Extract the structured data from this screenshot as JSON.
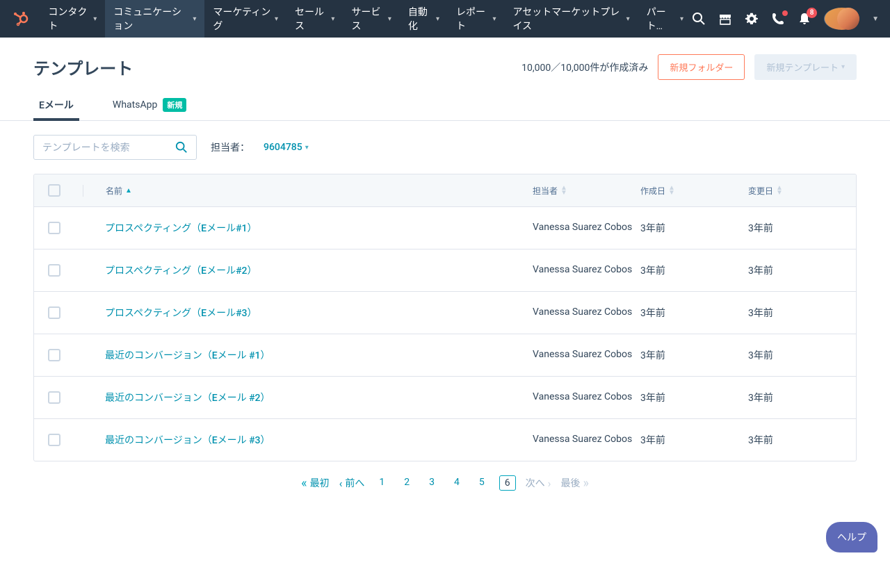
{
  "nav": {
    "items": [
      {
        "label": "コンタクト",
        "active": false
      },
      {
        "label": "コミュニケーション",
        "active": true
      },
      {
        "label": "マーケティング",
        "active": false
      },
      {
        "label": "セールス",
        "active": false
      },
      {
        "label": "サービス",
        "active": false
      },
      {
        "label": "自動化",
        "active": false
      },
      {
        "label": "レポート",
        "active": false
      },
      {
        "label": "アセットマーケットプレイス",
        "active": false
      },
      {
        "label": "パート…",
        "active": false
      }
    ],
    "notification_count": "8"
  },
  "page": {
    "title": "テンプレート",
    "count_text": "10,000／10,000件が作成済み",
    "new_folder_btn": "新規フォルダー",
    "new_template_btn": "新規テンプレート"
  },
  "tabs": {
    "email": "Eメール",
    "whatsapp": "WhatsApp",
    "new_badge": "新規"
  },
  "toolbar": {
    "search_placeholder": "テンプレートを検索",
    "filter_label": "担当者：",
    "filter_value": "9604785"
  },
  "table": {
    "headers": {
      "name": "名前",
      "owner": "担当者",
      "created": "作成日",
      "updated": "変更日"
    },
    "rows": [
      {
        "name": "プロスペクティング（Eメール#1）",
        "owner": "Vanessa Suarez Cobos",
        "created": "3年前",
        "updated": "3年前"
      },
      {
        "name": "プロスペクティング（Eメール#2）",
        "owner": "Vanessa Suarez Cobos",
        "created": "3年前",
        "updated": "3年前"
      },
      {
        "name": "プロスペクティング（Eメール#3）",
        "owner": "Vanessa Suarez Cobos",
        "created": "3年前",
        "updated": "3年前"
      },
      {
        "name": "最近のコンバージョン（Eメール #1）",
        "owner": "Vanessa Suarez Cobos",
        "created": "3年前",
        "updated": "3年前"
      },
      {
        "name": "最近のコンバージョン（Eメール #2）",
        "owner": "Vanessa Suarez Cobos",
        "created": "3年前",
        "updated": "3年前"
      },
      {
        "name": "最近のコンバージョン（Eメール #3）",
        "owner": "Vanessa Suarez Cobos",
        "created": "3年前",
        "updated": "3年前"
      }
    ]
  },
  "pagination": {
    "first": "最初",
    "prev": "前へ",
    "pages": [
      "1",
      "2",
      "3",
      "4",
      "5",
      "6"
    ],
    "current": "6",
    "next": "次へ",
    "last": "最後"
  },
  "help": {
    "label": "ヘルプ"
  }
}
